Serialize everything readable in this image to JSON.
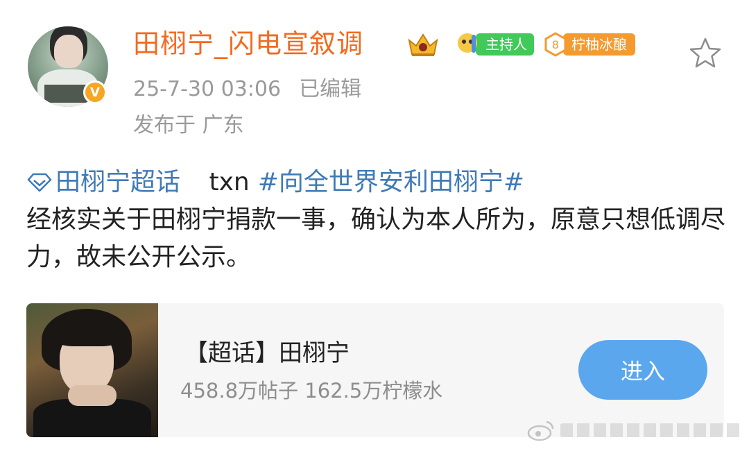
{
  "post": {
    "username": "田栩宁_闪电宣叙调",
    "badges": {
      "host_label": "主持人",
      "lemon_level": "8",
      "lemon_label": "柠柚冰酿"
    },
    "timestamp": "25-7-30 03:06",
    "edited": "已编辑",
    "location": "发布于 广东",
    "verified_mark": "V",
    "content": {
      "supertopic_link": "田栩宁超话",
      "txn": "txn",
      "hashtag": "#向全世界安利田栩宁#",
      "body": "经核实关于田栩宁捐款一事，确认为本人所为，原意只想低调尽力，故未公开公示。"
    }
  },
  "card": {
    "title": "【超话】田栩宁",
    "stats": "458.8万帖子 162.5万柠檬水",
    "button_label": "进入"
  },
  "icons": {
    "favorite": "star-icon",
    "topic": "supertopic-diamond-icon",
    "crown": "crown-icon",
    "weibo": "weibo-logo-icon"
  },
  "colors": {
    "username": "#f36a1e",
    "link": "#3f7ab8",
    "meta": "#9a9a9a",
    "host_badge": "#41c95a",
    "lemon_badge": "#f59a2f",
    "enter_button": "#5aa7ee"
  }
}
